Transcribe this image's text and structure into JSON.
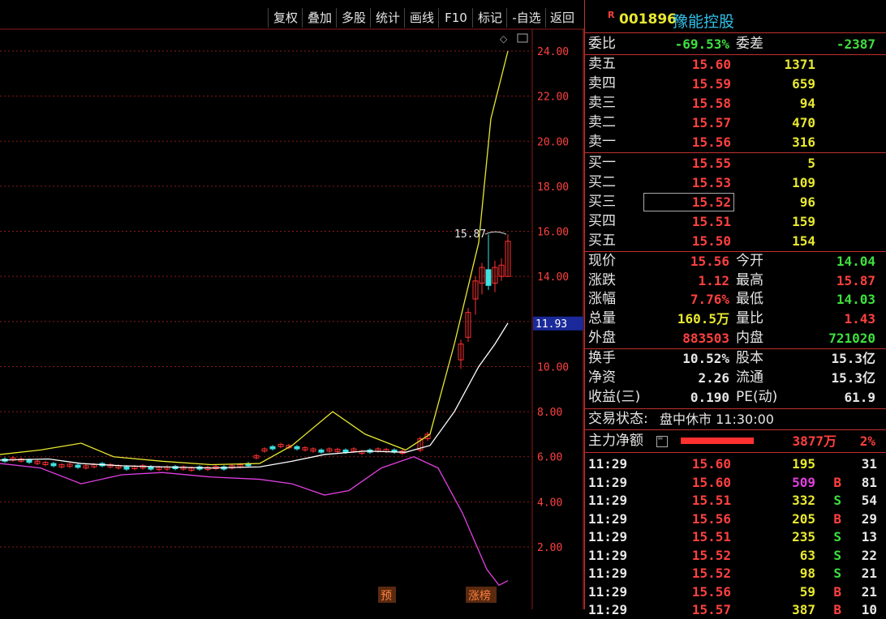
{
  "toolbar": {
    "buttons": [
      "复权",
      "叠加",
      "多股",
      "统计",
      "画线",
      "F10",
      "标记",
      "-自选",
      "返回"
    ]
  },
  "chart": {
    "y_labels": [
      "24.00",
      "22.00",
      "20.00",
      "18.00",
      "16.00",
      "14.00",
      "10.00",
      "8.00",
      "6.00",
      "4.00",
      "2.00"
    ],
    "current_price_label": "11.93",
    "high_annotation": "15.87",
    "markers": [
      "预",
      "涨榜"
    ],
    "colors": {
      "up": "#ff3030",
      "down": "#40e0e0",
      "ma1": "#ffffff",
      "ma2": "#e8e830",
      "ma3": "#e040e0",
      "grid": "#8a1a1a"
    }
  },
  "stock": {
    "badge": "R",
    "code": "001896",
    "name": "豫能控股"
  },
  "order_book": {
    "weibi_label": "委比",
    "weibi": "-69.53%",
    "weicha_label": "委差",
    "weicha": "-2387",
    "asks": [
      {
        "label": "卖五",
        "price": "15.60",
        "vol": "1371"
      },
      {
        "label": "卖四",
        "price": "15.59",
        "vol": "659"
      },
      {
        "label": "卖三",
        "price": "15.58",
        "vol": "94"
      },
      {
        "label": "卖二",
        "price": "15.57",
        "vol": "470"
      },
      {
        "label": "卖一",
        "price": "15.56",
        "vol": "316"
      }
    ],
    "bids": [
      {
        "label": "买一",
        "price": "15.55",
        "vol": "5"
      },
      {
        "label": "买二",
        "price": "15.53",
        "vol": "109"
      },
      {
        "label": "买三",
        "price": "15.52",
        "vol": "96"
      },
      {
        "label": "买四",
        "price": "15.51",
        "vol": "159"
      },
      {
        "label": "买五",
        "price": "15.50",
        "vol": "154"
      }
    ]
  },
  "stats": {
    "xianjia_label": "现价",
    "xianjia": "15.56",
    "jinkai_label": "今开",
    "jinkai": "14.04",
    "zhangdie_label": "涨跌",
    "zhangdie": "1.12",
    "zuigao_label": "最高",
    "zuigao": "15.87",
    "zhangfu_label": "涨幅",
    "zhangfu": "7.76%",
    "zuidi_label": "最低",
    "zuidi": "14.03",
    "zongliang_label": "总量",
    "zongliang": "160.5万",
    "liangbi_label": "量比",
    "liangbi": "1.43",
    "waipan_label": "外盘",
    "waipan": "883503",
    "neipan_label": "内盘",
    "neipan": "721020",
    "huanshou_label": "换手",
    "huanshou": "10.52%",
    "guben_label": "股本",
    "guben": "15.3亿",
    "jingzi_label": "净资",
    "jingzi": "2.26",
    "liutong_label": "流通",
    "liutong": "15.3亿",
    "shouyi_label": "收益(三)",
    "shouyi": "0.190",
    "pe_label": "PE(动)",
    "pe": "61.9"
  },
  "status": {
    "label": "交易状态:",
    "value": "盘中休市 11:30:00"
  },
  "main_force": {
    "label": "主力净额",
    "amount": "3877万",
    "pct": "2%"
  },
  "ticks": [
    {
      "time": "11:29",
      "price": "15.60",
      "vol": "195",
      "side": "",
      "n": "31"
    },
    {
      "time": "11:29",
      "price": "15.60",
      "vol": "509",
      "side": "B",
      "n": "81"
    },
    {
      "time": "11:29",
      "price": "15.51",
      "vol": "332",
      "side": "S",
      "n": "54"
    },
    {
      "time": "11:29",
      "price": "15.56",
      "vol": "205",
      "side": "B",
      "n": "29"
    },
    {
      "time": "11:29",
      "price": "15.51",
      "vol": "235",
      "side": "S",
      "n": "13"
    },
    {
      "time": "11:29",
      "price": "15.52",
      "vol": "63",
      "side": "S",
      "n": "22"
    },
    {
      "time": "11:29",
      "price": "15.52",
      "vol": "98",
      "side": "S",
      "n": "21"
    },
    {
      "time": "11:29",
      "price": "15.56",
      "vol": "59",
      "side": "B",
      "n": "21"
    },
    {
      "time": "11:29",
      "price": "15.57",
      "vol": "387",
      "side": "B",
      "n": "10"
    }
  ]
}
